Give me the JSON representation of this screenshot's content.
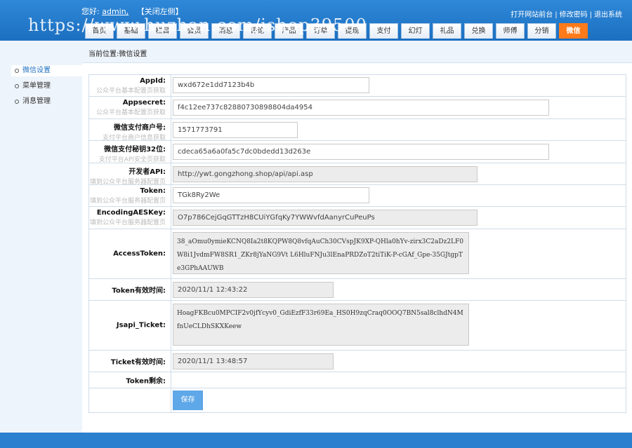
{
  "header": {
    "greeting_prefix": "您好:",
    "username": "admin,",
    "close_left": "【关闭左侧】",
    "links": [
      "打开网站前台",
      "修改密码",
      "退出系统"
    ],
    "link_separator": "|",
    "watermark": "https://www.huzhan.com/ishop39500"
  },
  "nav_tabs": [
    {
      "label": "首页"
    },
    {
      "label": "基础"
    },
    {
      "label": "栏目"
    },
    {
      "label": "会员"
    },
    {
      "label": "消息"
    },
    {
      "label": "评论"
    },
    {
      "label": "产品"
    },
    {
      "label": "订单"
    },
    {
      "label": "提现"
    },
    {
      "label": "支付"
    },
    {
      "label": "幻灯"
    },
    {
      "label": "礼品"
    },
    {
      "label": "兑换"
    },
    {
      "label": "师傅"
    },
    {
      "label": "分销"
    },
    {
      "label": "微信",
      "active": true
    }
  ],
  "breadcrumb": "当前位置:微信设置",
  "sidebar": {
    "items": [
      {
        "label": "微信设置",
        "active": true
      },
      {
        "label": "菜单管理"
      },
      {
        "label": "消息管理"
      }
    ]
  },
  "form": {
    "appid": {
      "label": "AppId:",
      "hint": "公众平台基本配置页获取",
      "value": "wxd672e1dd7123b4b"
    },
    "appsecret": {
      "label": "Appsecret:",
      "hint": "公众平台基本配置页获取",
      "value": "f4c12ee737c82880730898804da4954"
    },
    "mchid": {
      "label": "微信支付商户号:",
      "hint": "支付平台商户信息获取",
      "value": "1571773791"
    },
    "paykey": {
      "label": "微信支付秘钥32位:",
      "hint": "支付平台API安全页获取",
      "value": "cdeca65a6a0fa5c7dc0bdedd13d263e"
    },
    "devapi": {
      "label": "开发者API:",
      "hint": "填到公众平台服务器配置页",
      "value": "http://ywt.gongzhong.shop/api/api.asp"
    },
    "token": {
      "label": "Token:",
      "hint": "填到公众平台服务器配置页",
      "value": "TGk8Ry2We"
    },
    "aeskey": {
      "label": "EncodingAESKey:",
      "hint": "填到公众平台服务器配置页",
      "value": "O7p786CejGqGTTzH8CUiYGfqKy7YWWvfdAanyrCuPeuPs"
    },
    "accesstoken": {
      "label": "AccessToken:",
      "value": "38_aOmu0ymieKCNQ8Ia2t8KQPW8Q8vfqAuCh30CVspJK9XP-QHla0hYv-zirx3C2aDz2LF0W8i1JvdmFW8SR1_ZKr8jYaNG9Vt L6HluFNJu3lEnaPRDZoT2tiTiK-P-cGAf_Gpe-35GJtgpTe3GPhAAUWB"
    },
    "token_expire": {
      "label": "Token有效时间:",
      "value": "2020/11/1 12:43:22"
    },
    "jsapi": {
      "label": "Jsapi_Ticket:",
      "value": "HoagFKBcu0MPCIF2v0jfYcyv0_GdiEzfF33r69Ea_HS0H9zqCraq0OOQ7BN5sal8clhdN4MfnUeCLDhSKXKeew"
    },
    "ticket_expire": {
      "label": "Ticket有效时间:",
      "value": "2020/11/1 13:48:57"
    },
    "token_left": {
      "label": "Token剩余:"
    },
    "save_label": "保存"
  }
}
